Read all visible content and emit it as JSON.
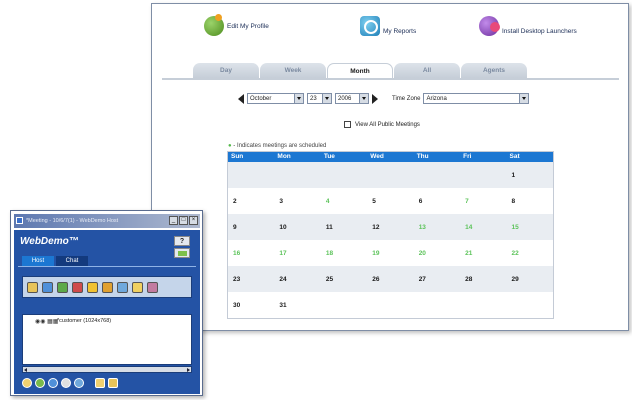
{
  "main": {
    "links": [
      {
        "label": "Edit My Profile",
        "icon": "profile-icon"
      },
      {
        "label": "My Reports",
        "icon": "reports-icon"
      },
      {
        "label": "Install Desktop Launchers",
        "icon": "launcher-icon"
      }
    ],
    "tabs": [
      "Day",
      "Week",
      "Month",
      "All",
      "Agents"
    ],
    "active_tab": "Month",
    "date": {
      "month": "October",
      "day": "23",
      "year": "2006"
    },
    "timezone_label": "Time Zone",
    "timezone_value": "Arizona",
    "public_meetings_label": "View All Public Meetings",
    "legend_text": "- Indicates meetings are scheduled",
    "weekdays": [
      "Sun",
      "Mon",
      "Tue",
      "Wed",
      "Thu",
      "Fri",
      "Sat"
    ],
    "weeks": [
      [
        {
          "d": ""
        },
        {
          "d": ""
        },
        {
          "d": ""
        },
        {
          "d": ""
        },
        {
          "d": ""
        },
        {
          "d": ""
        },
        {
          "d": "1"
        }
      ],
      [
        {
          "d": "2"
        },
        {
          "d": "3"
        },
        {
          "d": "4",
          "s": true
        },
        {
          "d": "5"
        },
        {
          "d": "6"
        },
        {
          "d": "7",
          "s": true
        },
        {
          "d": "8"
        }
      ],
      [
        {
          "d": "9"
        },
        {
          "d": "10"
        },
        {
          "d": "11"
        },
        {
          "d": "12"
        },
        {
          "d": "13",
          "s": true
        },
        {
          "d": "14",
          "s": true
        },
        {
          "d": "15",
          "s": true
        }
      ],
      [
        {
          "d": "16",
          "s": true
        },
        {
          "d": "17",
          "s": true
        },
        {
          "d": "18",
          "s": true
        },
        {
          "d": "19",
          "s": true
        },
        {
          "d": "20",
          "s": true
        },
        {
          "d": "21",
          "s": true
        },
        {
          "d": "22",
          "s": true
        }
      ],
      [
        {
          "d": "23"
        },
        {
          "d": "24"
        },
        {
          "d": "25"
        },
        {
          "d": "26"
        },
        {
          "d": "27"
        },
        {
          "d": "28"
        },
        {
          "d": "29"
        }
      ],
      [
        {
          "d": "30"
        },
        {
          "d": "31"
        },
        {
          "d": ""
        },
        {
          "d": ""
        },
        {
          "d": ""
        },
        {
          "d": ""
        },
        {
          "d": ""
        }
      ]
    ]
  },
  "mini": {
    "title": "*Meeting - 10/6/7(1) - WebDemo Host",
    "brand": "WebDemo™",
    "help_label": "?",
    "tabs": [
      "Host",
      "Chat"
    ],
    "panel_text": "*customer (1024x768)"
  }
}
